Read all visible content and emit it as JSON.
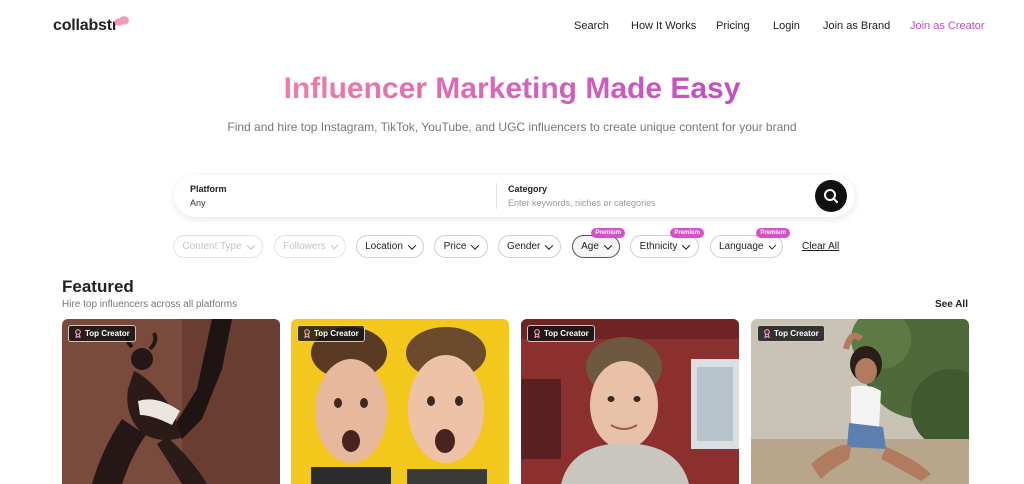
{
  "header": {
    "logo": "collabstr",
    "nav": [
      {
        "label": "Search"
      },
      {
        "label": "How It Works"
      },
      {
        "label": "Pricing"
      },
      {
        "label": "Login"
      },
      {
        "label": "Join as Brand"
      },
      {
        "label": "Join as Creator"
      }
    ]
  },
  "hero": {
    "title": "Influencer Marketing Made Easy",
    "subtitle": "Find and hire top Instagram, TikTok, YouTube, and UGC influencers to create unique content for your brand"
  },
  "search": {
    "platform_label": "Platform",
    "platform_value": "Any",
    "category_label": "Category",
    "category_placeholder": "Enter keywords, niches or categories"
  },
  "filters": [
    {
      "label": "Content Type"
    },
    {
      "label": "Followers"
    },
    {
      "label": "Location"
    },
    {
      "label": "Price"
    },
    {
      "label": "Gender"
    },
    {
      "label": "Age",
      "badge": "Premium"
    },
    {
      "label": "Ethnicity",
      "badge": "Premium"
    },
    {
      "label": "Language",
      "badge": "Premium"
    }
  ],
  "clear_all": "Clear All",
  "featured": {
    "title": "Featured",
    "subtitle": "Hire top influencers across all platforms",
    "see_all": "See All",
    "cards": [
      {
        "badge": "Top Creator"
      },
      {
        "badge": "Top Creator"
      },
      {
        "badge": "Top Creator"
      },
      {
        "badge": "Top Creator"
      }
    ]
  },
  "colors": {
    "accent": "#c04ec0",
    "gradient_start": "#f07aa8",
    "gradient_end": "#c24fc4",
    "premium": "#d94fc8"
  }
}
